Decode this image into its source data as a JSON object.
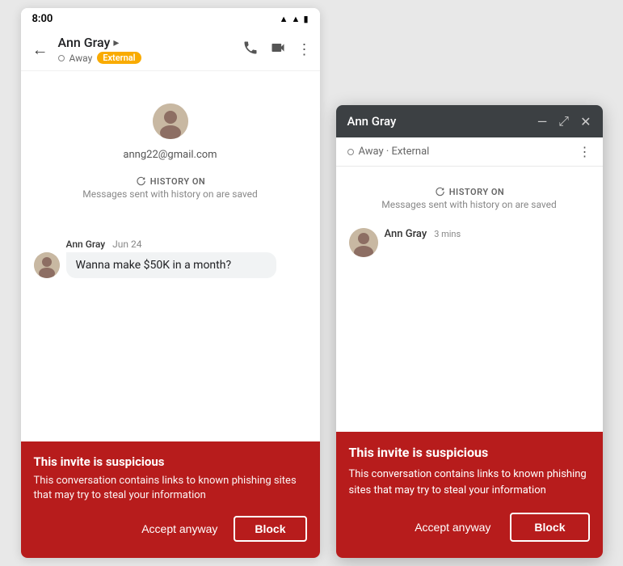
{
  "mobile": {
    "status_bar": {
      "time": "8:00"
    },
    "header": {
      "back_label": "←",
      "name": "Ann Gray",
      "chevron": "▸",
      "status": "Away",
      "badge": "External",
      "phone_icon": "📞",
      "video_icon": "▭",
      "more_icon": "⋮"
    },
    "chat": {
      "email": "anng22@gmail.com",
      "history_label": "HISTORY ON",
      "history_sub": "Messages sent with history on are saved",
      "message_sender": "Ann Gray",
      "message_date": "Jun 24",
      "message_text": "Wanna make $50K in a month?"
    },
    "warning": {
      "title": "This invite is suspicious",
      "text": "This conversation contains links to known phishing sites that may try to steal your information",
      "accept_label": "Accept anyway",
      "block_label": "Block"
    }
  },
  "desktop": {
    "title_bar": {
      "name": "Ann Gray",
      "minimize": "—",
      "maximize": "⤢",
      "close": "✕"
    },
    "status": {
      "away": "Away · External",
      "more_icon": "⋮"
    },
    "chat": {
      "history_label": "HISTORY ON",
      "history_sub": "Messages sent with history on are saved",
      "message_sender": "Ann Gray",
      "message_time": "3 mins"
    },
    "warning": {
      "title": "This invite is suspicious",
      "text": "This conversation contains links to known phishing sites that may try to steal your information",
      "accept_label": "Accept anyway",
      "block_label": "Block"
    }
  }
}
